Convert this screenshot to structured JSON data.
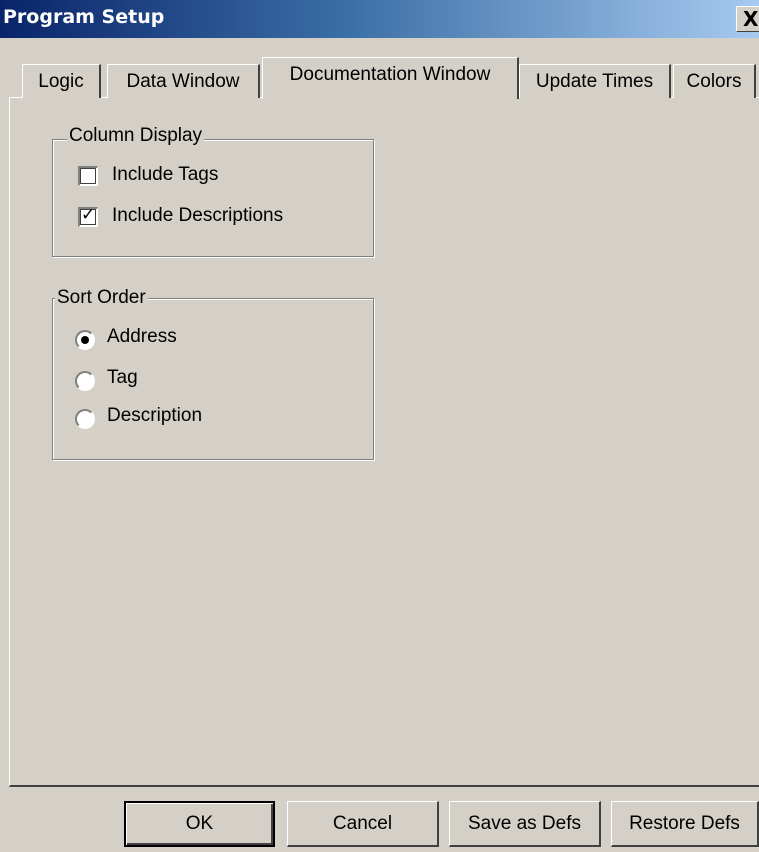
{
  "window": {
    "title": "Program Setup",
    "close_symbol": "X"
  },
  "tabs": [
    {
      "label": "Logic",
      "active": false
    },
    {
      "label": "Data Window",
      "active": false
    },
    {
      "label": "Documentation Window",
      "active": true
    },
    {
      "label": "Update Times",
      "active": false
    },
    {
      "label": "Colors",
      "active": false
    }
  ],
  "column_display": {
    "label": "Column Display",
    "options": [
      {
        "label": "Include Tags",
        "checked": false
      },
      {
        "label": "Include Descriptions",
        "checked": true
      }
    ]
  },
  "sort_order": {
    "label": "Sort Order",
    "options": [
      {
        "label": "Address",
        "selected": true
      },
      {
        "label": "Tag",
        "selected": false
      },
      {
        "label": "Description",
        "selected": false
      }
    ]
  },
  "buttons": {
    "ok": "OK",
    "cancel": "Cancel",
    "save_defs": "Save as Defs",
    "restore_defs": "Restore Defs"
  },
  "colors": {
    "title_bar_start": "#0a246a",
    "title_bar_end": "#a6caf0",
    "dialog_bg": "#d4d0c8"
  }
}
